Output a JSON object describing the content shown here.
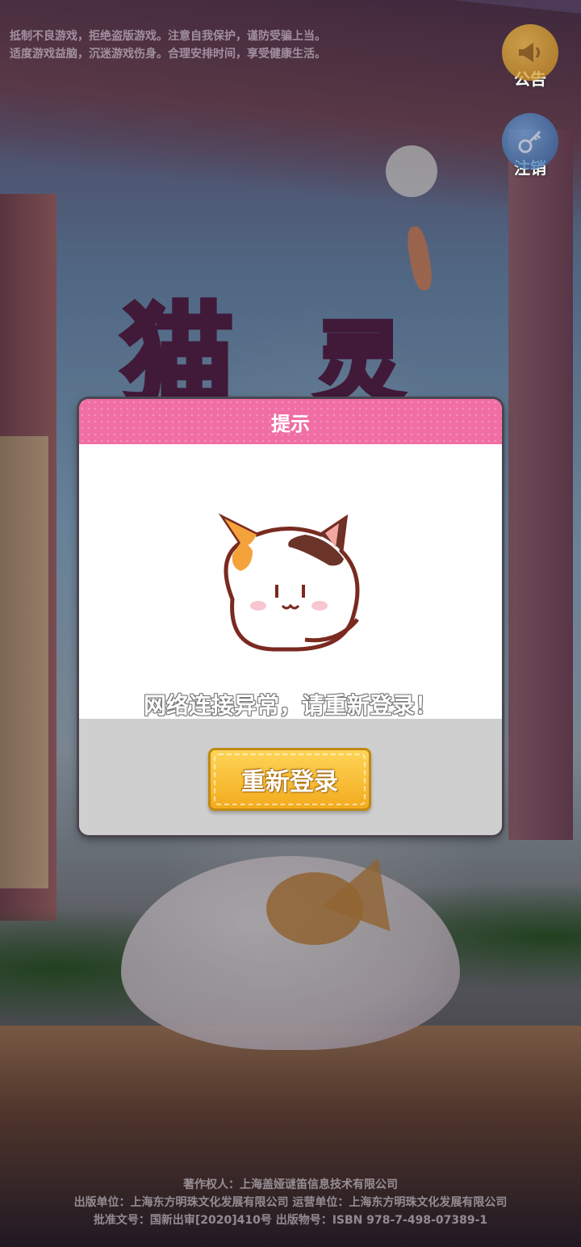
{
  "notice_lines": [
    "抵制不良游戏，拒绝盗版游戏。注意自我保护，谨防受骗上当。",
    "适度游戏益脑，沉迷游戏伤身。合理安排时间，享受健康生活。"
  ],
  "side_buttons": {
    "announcement": {
      "label": "公告",
      "icon": "megaphone-icon"
    },
    "logout": {
      "label": "注销",
      "icon": "key-icon"
    }
  },
  "logo": {
    "chars": [
      "猫",
      "灵"
    ]
  },
  "dialog": {
    "title": "提示",
    "message": "网络连接异常，请重新登录！",
    "button_label": "重新登录",
    "colors": {
      "header": "#f06ea3",
      "button": "#f5b525"
    }
  },
  "copyright_lines": [
    "著作权人：上海盖娅谜笛信息技术有限公司",
    "出版单位：上海东方明珠文化发展有限公司   运营单位：上海东方明珠文化发展有限公司",
    "批准文号：国新出审[2020]410号   出版物号：ISBN 978-7-498-07389-1"
  ]
}
